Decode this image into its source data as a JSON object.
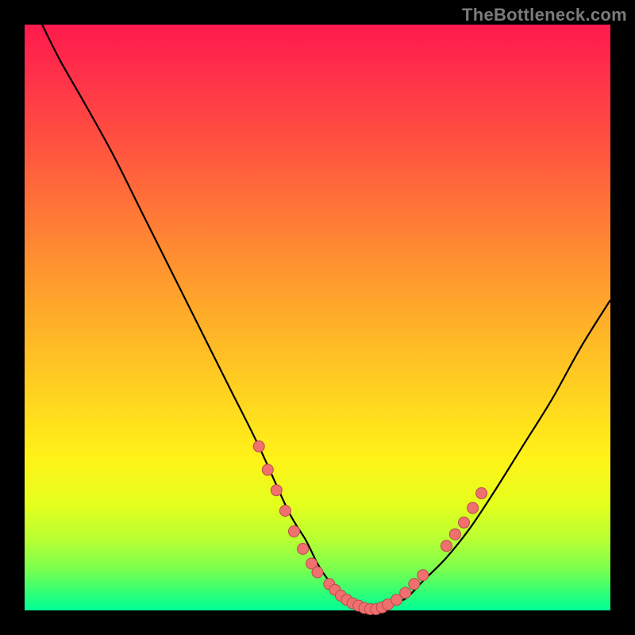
{
  "watermark": "TheBottleneck.com",
  "colors": {
    "background": "#000000",
    "gradient_top": "#ff1a4d",
    "gradient_bottom": "#00ff96",
    "curve": "#000000",
    "dot_fill": "#f07070",
    "dot_stroke": "#b84a4a",
    "watermark_text": "#7b7b7b"
  },
  "chart_data": {
    "type": "line",
    "title": "",
    "xlabel": "",
    "ylabel": "",
    "xlim": [
      0,
      100
    ],
    "ylim": [
      0,
      100
    ],
    "grid": false,
    "legend": false,
    "description": "Smooth V-shaped bottleneck curve; y≈100 at left edge, drops to y≈0 near x≈55–60, rises to y≈53 at right edge. Lower is better (green region near bottom).",
    "series": [
      {
        "name": "bottleneck-curve",
        "x": [
          3,
          6,
          10,
          15,
          20,
          25,
          30,
          35,
          40,
          45,
          48,
          50,
          52,
          54,
          56,
          58,
          60,
          62,
          65,
          68,
          72,
          76,
          80,
          85,
          90,
          95,
          100
        ],
        "y": [
          100,
          94,
          87,
          78,
          68,
          58,
          48,
          38,
          28,
          17,
          12,
          8,
          5,
          3,
          1,
          0,
          0,
          1,
          2,
          5,
          9,
          14,
          20,
          28,
          36,
          45,
          53
        ]
      }
    ],
    "scatter_overlay": {
      "name": "highlighted-points",
      "comment": "Dense dots along bottom of V and on lower flanks",
      "points": [
        {
          "x": 40.0,
          "y": 28.0
        },
        {
          "x": 41.5,
          "y": 24.0
        },
        {
          "x": 43.0,
          "y": 20.5
        },
        {
          "x": 44.5,
          "y": 17.0
        },
        {
          "x": 46.0,
          "y": 13.5
        },
        {
          "x": 47.5,
          "y": 10.5
        },
        {
          "x": 49.0,
          "y": 8.0
        },
        {
          "x": 50.0,
          "y": 6.5
        },
        {
          "x": 52.0,
          "y": 4.5
        },
        {
          "x": 53.0,
          "y": 3.5
        },
        {
          "x": 54.0,
          "y": 2.5
        },
        {
          "x": 55.0,
          "y": 1.8
        },
        {
          "x": 56.0,
          "y": 1.2
        },
        {
          "x": 57.0,
          "y": 0.8
        },
        {
          "x": 58.0,
          "y": 0.4
        },
        {
          "x": 59.0,
          "y": 0.2
        },
        {
          "x": 60.0,
          "y": 0.2
        },
        {
          "x": 61.0,
          "y": 0.5
        },
        {
          "x": 62.0,
          "y": 1.0
        },
        {
          "x": 63.5,
          "y": 1.8
        },
        {
          "x": 65.0,
          "y": 3.0
        },
        {
          "x": 66.5,
          "y": 4.5
        },
        {
          "x": 68.0,
          "y": 6.0
        },
        {
          "x": 72.0,
          "y": 11.0
        },
        {
          "x": 73.5,
          "y": 13.0
        },
        {
          "x": 75.0,
          "y": 15.0
        },
        {
          "x": 76.5,
          "y": 17.5
        },
        {
          "x": 78.0,
          "y": 20.0
        }
      ]
    }
  }
}
